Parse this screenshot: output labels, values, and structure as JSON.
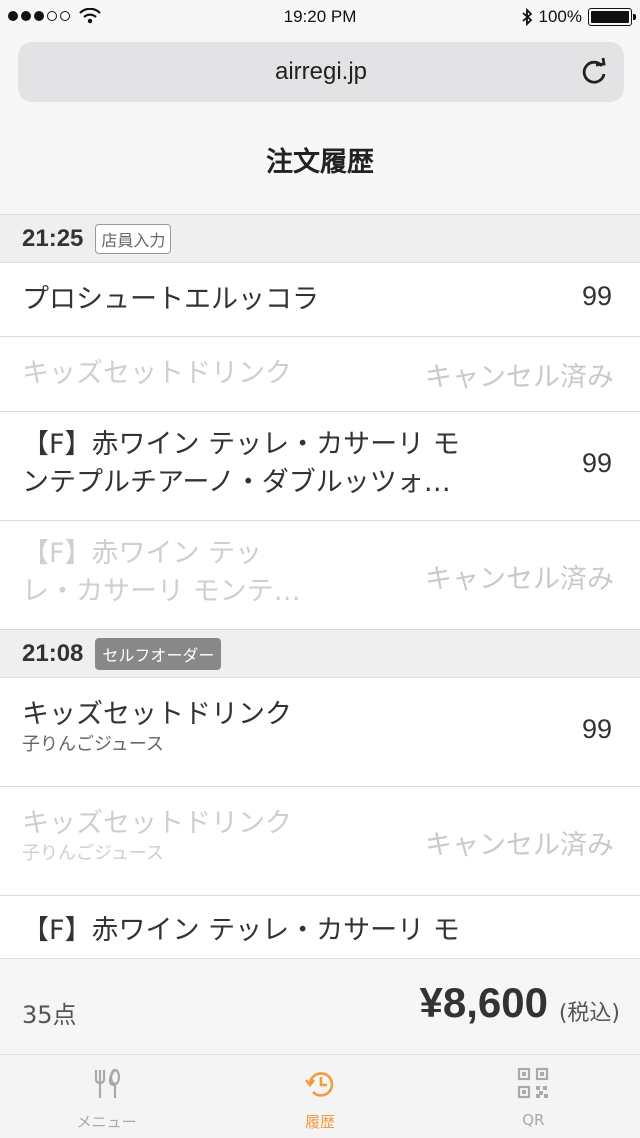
{
  "status_bar": {
    "time": "19:20 PM",
    "battery": "100%"
  },
  "browser": {
    "url": "airregi.jp"
  },
  "page": {
    "title": "注文履歴"
  },
  "sections": [
    {
      "time": "21:25",
      "tag": "店員入力",
      "items": [
        {
          "name_line1": "プロシュートエルッコラ",
          "qty": "99"
        },
        {
          "name_line1": "キッズセットドリンク",
          "status": "キャンセル済み"
        },
        {
          "name_line1": "【F】赤ワイン テッレ・カサーリ モ",
          "name_line2": "ンテプルチアーノ・ダブルッツォ…",
          "qty": "99"
        },
        {
          "name_line1": "【F】赤ワイン テッ",
          "name_line2": "レ・カサーリ モンテ…",
          "status": "キャンセル済み"
        }
      ]
    },
    {
      "time": "21:08",
      "tag": "セルフオーダー",
      "items": [
        {
          "name_line1": "キッズセットドリンク",
          "sub": "子りんごジュース",
          "qty": "99"
        },
        {
          "name_line1": "キッズセットドリンク",
          "sub": "子りんごジュース",
          "status": "キャンセル済み"
        },
        {
          "name_line1": "【F】赤ワイン テッレ・カサーリ モ"
        }
      ]
    }
  ],
  "summary": {
    "count": "35点",
    "total": "¥8,600",
    "tax_note": "(税込)"
  },
  "tabs": [
    {
      "label": "メニュー",
      "icon": "fork-knife-icon"
    },
    {
      "label": "履歴",
      "icon": "history-icon",
      "active": true
    },
    {
      "label": "QR",
      "icon": "qr-code-icon"
    }
  ],
  "colors": {
    "accent": "#f39a3e",
    "cancelled_text": "#cfcfcf",
    "tag_fill": "#888888"
  }
}
